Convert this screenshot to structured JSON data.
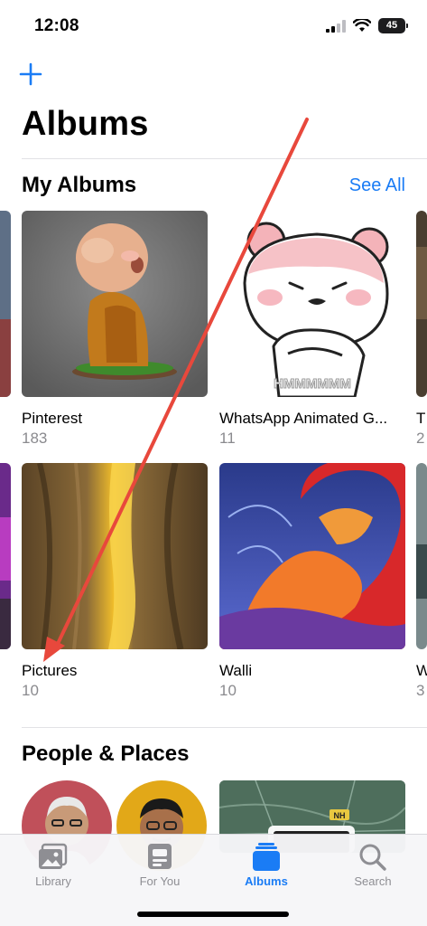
{
  "status": {
    "time": "12:08",
    "battery": "45"
  },
  "header": {
    "title": "Albums"
  },
  "my_albums": {
    "title": "My Albums",
    "see_all_label": "See All",
    "albums": [
      {
        "name": "Pinterest",
        "count": "183"
      },
      {
        "name": "WhatsApp Animated G...",
        "count": "11",
        "sticker_text": "HMMMMMM"
      },
      {
        "name": "Pictures",
        "count": "10"
      },
      {
        "name": "Walli",
        "count": "10"
      }
    ],
    "peek_right": {
      "name": "T",
      "count": "2"
    },
    "peek_right_2": {
      "name": "W",
      "count": "3"
    }
  },
  "people_places": {
    "title": "People & Places",
    "map_badge": "NH"
  },
  "tabs": [
    {
      "label": "Library",
      "icon": "photo-library-icon",
      "active": false
    },
    {
      "label": "For You",
      "icon": "for-you-icon",
      "active": false
    },
    {
      "label": "Albums",
      "icon": "albums-icon",
      "active": true
    },
    {
      "label": "Search",
      "icon": "search-icon",
      "active": false
    }
  ],
  "colors": {
    "accent": "#1a7cf5",
    "annotation_arrow": "#e8483c"
  }
}
